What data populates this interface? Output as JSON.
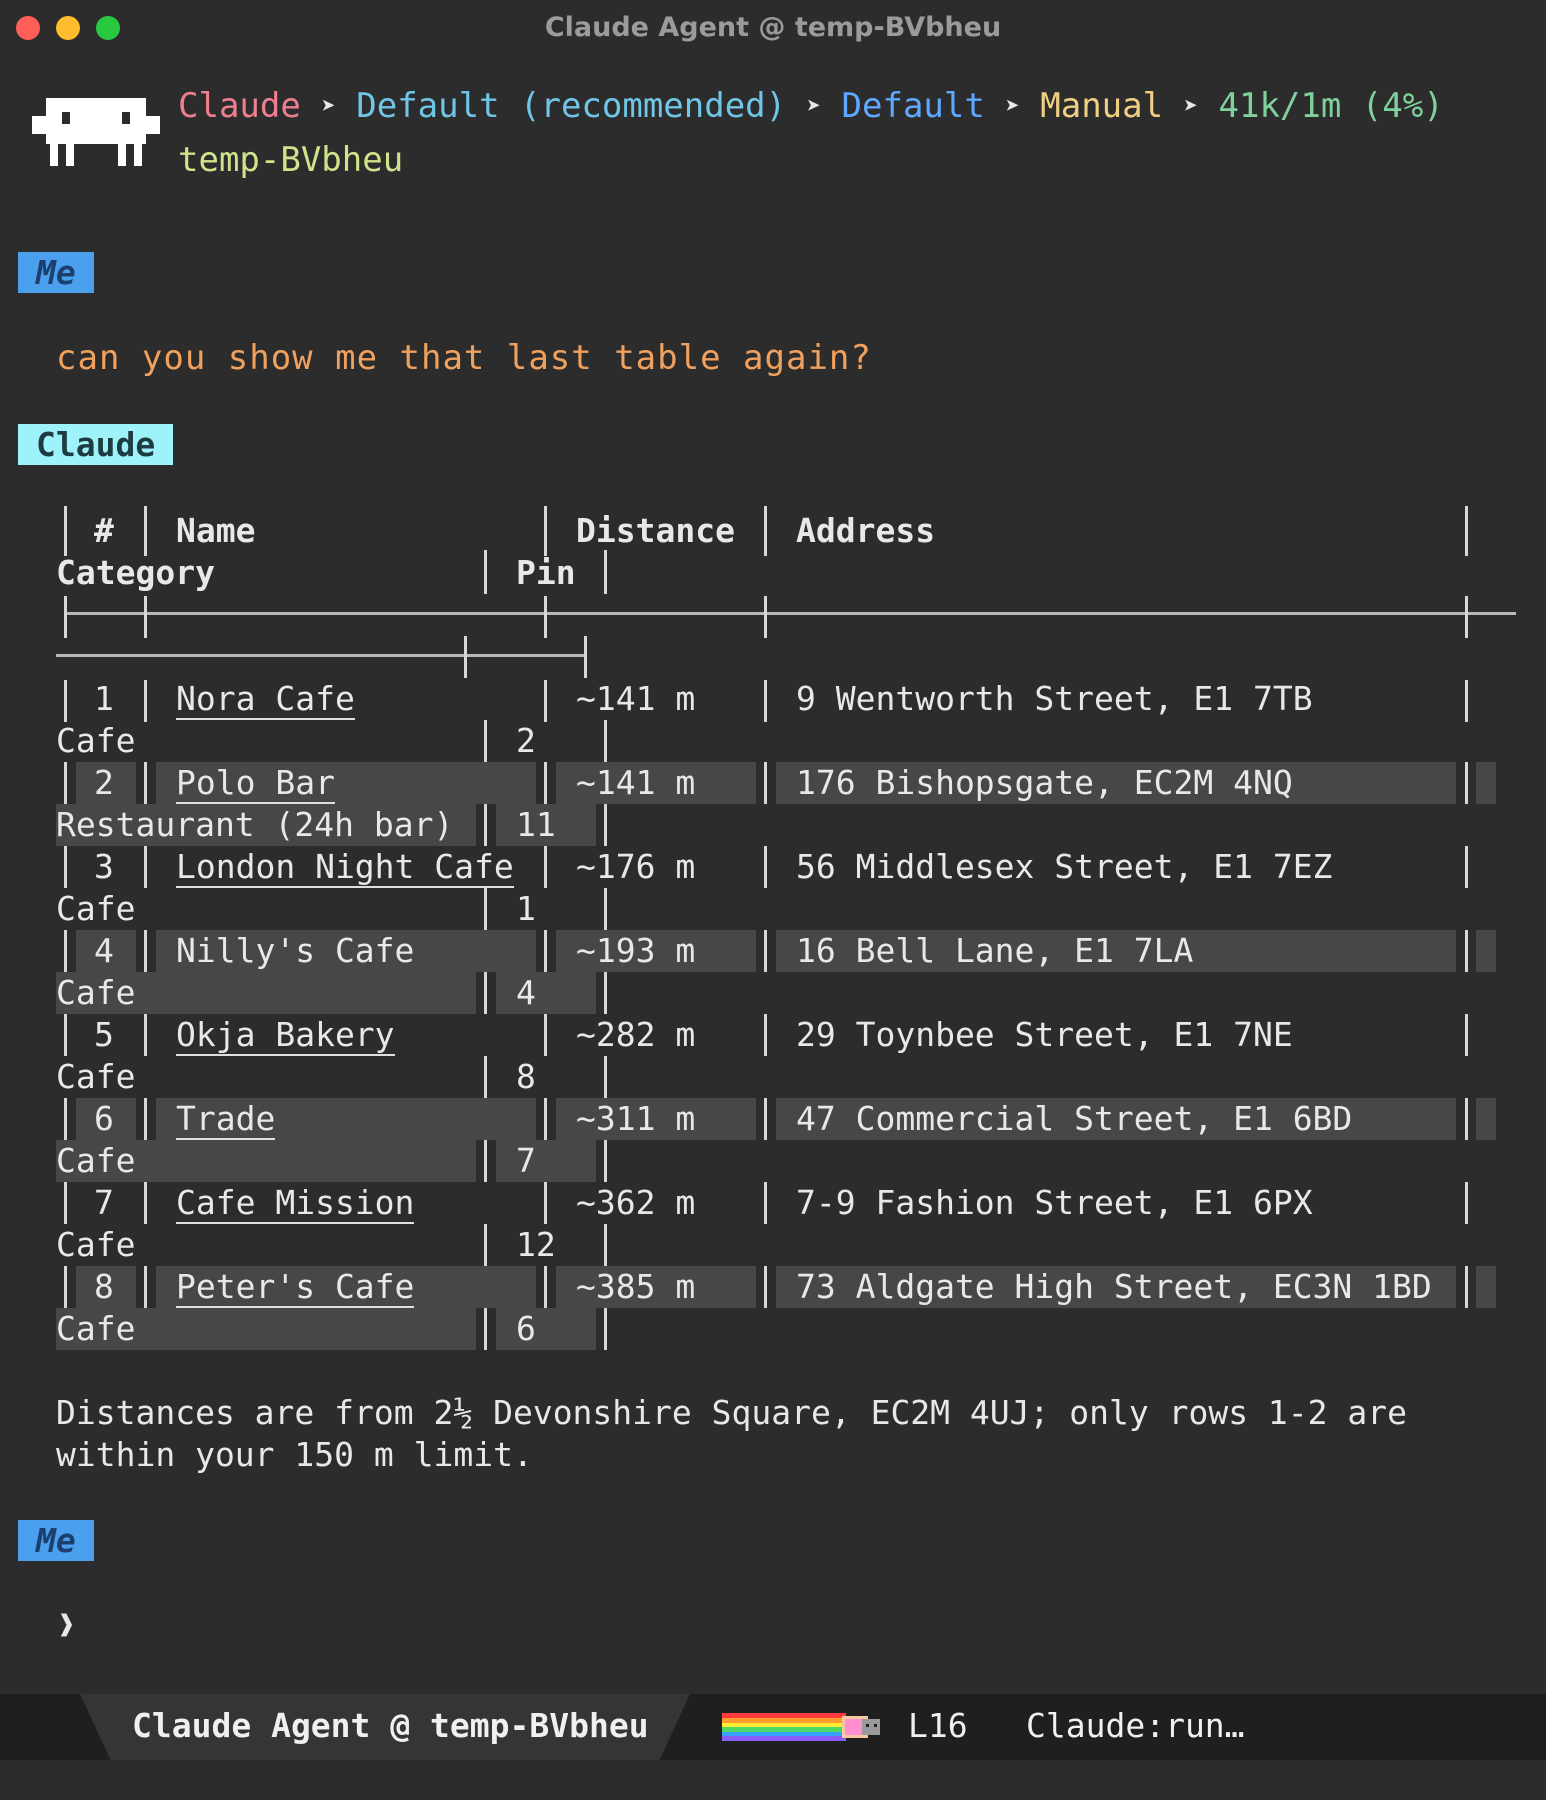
{
  "window": {
    "title": "Claude Agent @ temp-BVbheu"
  },
  "header": {
    "crumbs": [
      "Claude",
      "Default (recommended)",
      "Default",
      "Manual",
      "41k/1m (4%)"
    ],
    "cwd": "temp-BVbheu"
  },
  "messages": {
    "me_label": "Me",
    "claude_label": "Claude",
    "user_text": "can you show me that last table again?"
  },
  "table": {
    "headers": {
      "num": "#",
      "name": "Name",
      "distance": "Distance",
      "address": "Address",
      "category": "Category",
      "pin": "Pin"
    },
    "rows": [
      {
        "num": "1",
        "name": "Nora Cafe",
        "distance": "~141 m",
        "address": "9 Wentworth Street, E1 7TB",
        "category": "Cafe",
        "pin": "2"
      },
      {
        "num": "2",
        "name": "Polo Bar",
        "distance": "~141 m",
        "address": "176 Bishopsgate, EC2M 4NQ",
        "category": "Restaurant (24h bar)",
        "pin": "11"
      },
      {
        "num": "3",
        "name": "London Night Cafe",
        "distance": "~176 m",
        "address": "56 Middlesex Street, E1 7EZ",
        "category": "Cafe",
        "pin": "1"
      },
      {
        "num": "4",
        "name": "Nilly's Cafe",
        "distance": "~193 m",
        "address": "16 Bell Lane, E1 7LA",
        "category": "Cafe",
        "pin": "4"
      },
      {
        "num": "5",
        "name": "Okja Bakery",
        "distance": "~282 m",
        "address": "29 Toynbee Street, E1 7NE",
        "category": "Cafe",
        "pin": "8"
      },
      {
        "num": "6",
        "name": "Trade",
        "distance": "~311 m",
        "address": "47 Commercial Street, E1 6BD",
        "category": "Cafe",
        "pin": "7"
      },
      {
        "num": "7",
        "name": "Cafe Mission",
        "distance": "~362 m",
        "address": "7-9 Fashion Street, E1 6PX",
        "category": "Cafe",
        "pin": "12"
      },
      {
        "num": "8",
        "name": "Peter's Cafe",
        "distance": "~385 m",
        "address": "73 Aldgate High Street, EC3N 1BD",
        "category": "Cafe",
        "pin": "6"
      }
    ]
  },
  "footnote": {
    "line1": "Distances are from 2½ Devonshire Square, EC2M 4UJ; only rows 1-2 are",
    "line2": "within your 150 m limit."
  },
  "prompt": {
    "symbol": "❱"
  },
  "statusbar": {
    "title": "Claude Agent @ temp-BVbheu",
    "line": "L16",
    "process": "Claude:run…"
  }
}
